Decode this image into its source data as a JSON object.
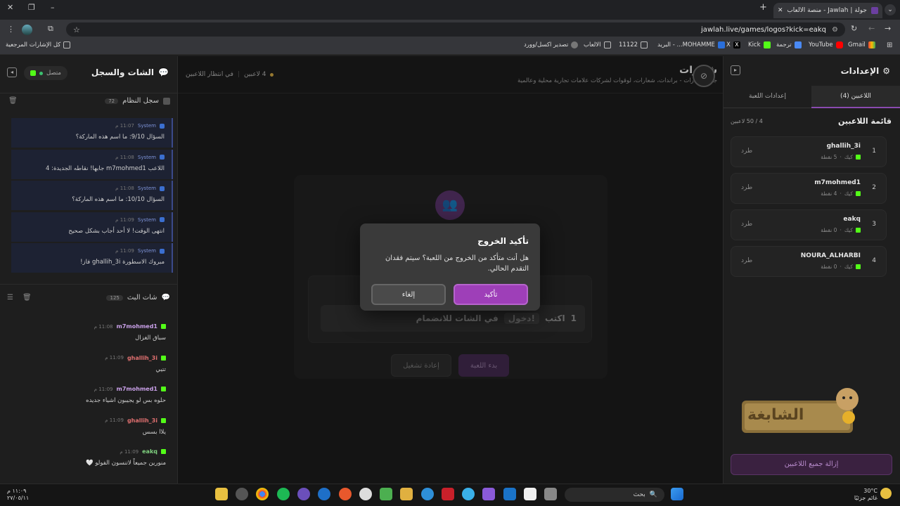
{
  "browser": {
    "tab_title": "جولة | Jawlah - منصة الألعاب الث...",
    "url": "jawlah.live/games/logos?kick=eakq",
    "bookmarks": [
      "Gmail",
      "YouTube",
      "ترجمة",
      "Kick",
      "X",
      "البريد - ...MOHAMME",
      "11122",
      "الالعاب",
      "تصدير اكسل/وورد"
    ],
    "all_bookmarks": "كل الإشارات المرجعية"
  },
  "settings": {
    "title": "الإعدادات",
    "tab_players": "اللاعبين (4)",
    "tab_game": "إعدادات اللعبة",
    "list_title": "قائمة اللاعبين",
    "count": "4 / 50 لاعبين",
    "kick_label": "طرد",
    "players": [
      {
        "rank": "1",
        "name": "ghallih_3i",
        "platform": "كيك",
        "points": "5 نقطة"
      },
      {
        "rank": "2",
        "name": "m7mohmed1",
        "platform": "كيك",
        "points": "4 نقطة"
      },
      {
        "rank": "3",
        "name": "eakq",
        "platform": "كيك",
        "points": "0 نقطة"
      },
      {
        "rank": "4",
        "name": "NOURA_ALHARBI",
        "platform": "كيك",
        "points": "0 نقطة"
      }
    ],
    "remove_all": "إزالة جميع اللاعبين"
  },
  "game": {
    "title": "شعارات",
    "subtitle": "جولة شعارات - براندات، شعارات، لوقوات لشركات علامات تجارية محلية وعالمية",
    "players_count": "4 لاعبين",
    "status": "في انتظار اللاعبين",
    "step_number": "1",
    "step_text": "اكتب",
    "step_keyword": "!دخول",
    "step_suffix": "في الشات للانضمام",
    "start_button": "بدء اللعبة",
    "restart_button": "إعادة تشغيل",
    "logo_text": "الشابغة"
  },
  "modal": {
    "title": "تأكيد الخروج",
    "body": "هل أنت متأكد من الخروج من اللعبة؟ سيتم فقدان التقدم الحالي.",
    "confirm": "تأكيد",
    "cancel": "إلغاء"
  },
  "chat": {
    "title": "الشات والسجل",
    "status": "متصل",
    "log_title": "سجل النظام",
    "log_count": "72",
    "log": [
      {
        "author": "System",
        "time": "11:07 م",
        "text": "السؤال 9/10: ما اسم هذه الماركة؟"
      },
      {
        "author": "System",
        "time": "11:08 م",
        "text": "اللاعب m7mohmed1 جابها! نقاطه الجديدة: 4"
      },
      {
        "author": "System",
        "time": "11:08 م",
        "text": "السؤال 10/10: ما اسم هذه الماركة؟"
      },
      {
        "author": "System",
        "time": "11:09 م",
        "text": "انتهى الوقت! لا أحد أجاب بشكل صحيح"
      },
      {
        "author": "System",
        "time": "11:09 م",
        "text": "مبروك الاسطورة ghallih_3i فاز!"
      }
    ],
    "live_title": "شات البث",
    "live_count": "125",
    "messages": [
      {
        "author": "m7mohmed1",
        "time": "11:08 م",
        "text": "سباق الغزال",
        "color": "#c9a0e8"
      },
      {
        "author": "ghallih_3i",
        "time": "11:09 م",
        "text": "تتيي",
        "color": "#e07070"
      },
      {
        "author": "m7mohmed1",
        "time": "11:09 م",
        "text": "حلوه بس لو يجيبون اشياء جديده",
        "color": "#c9a0e8"
      },
      {
        "author": "ghallih_3i",
        "time": "11:09 م",
        "text": "يلاا بسس",
        "color": "#e07070"
      },
      {
        "author": "eakq",
        "time": "11:09 م",
        "text": "منورين جميعاً لاتنسون الفولو 🤍",
        "color": "#7fd17f"
      }
    ]
  },
  "taskbar": {
    "search": "بحث",
    "weather_temp": "30°C",
    "weather_text": "غائم جزئيًا",
    "time": "١١:٠٩ م",
    "date": "٢٧/٠٥/١١"
  }
}
